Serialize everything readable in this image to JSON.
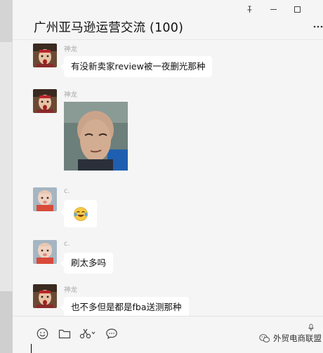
{
  "window": {
    "title": "广州亚马逊运营交流 (100)",
    "pin_icon": "pin-icon",
    "minimize_icon": "minimize-icon",
    "maximize_icon": "maximize-icon",
    "more_icon": "more-icon"
  },
  "messages": [
    {
      "sender": "神龙",
      "type": "text",
      "text": "有没新卖家review被一夜删光那种",
      "avatar": "opera-avatar"
    },
    {
      "sender": "神龙",
      "type": "image",
      "avatar": "opera-avatar",
      "image": "bald-man-photo"
    },
    {
      "sender": "c.",
      "type": "emoji",
      "avatar": "baby-avatar",
      "emoji": "laughing-crying-emoji"
    },
    {
      "sender": "c.",
      "type": "text",
      "text": "刷太多吗",
      "avatar": "baby-avatar"
    },
    {
      "sender": "神龙",
      "type": "text",
      "text": "也不多但是都是fba送测那种",
      "avatar": "opera-avatar"
    }
  ],
  "toolbar": {
    "items": [
      "emoji-icon",
      "folder-icon",
      "scissors-icon",
      "chat-history-icon"
    ]
  },
  "watermark": "外贸电商联盟",
  "colors": {
    "background": "#f5f5f5",
    "bubble": "#ffffff",
    "sender_text": "#a8a8a8"
  }
}
